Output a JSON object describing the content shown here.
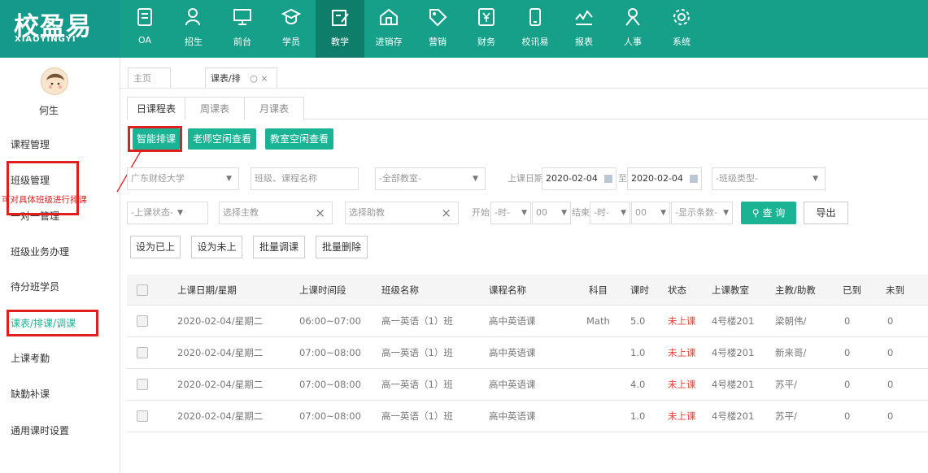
{
  "brand": {
    "name_cn": "校盈易",
    "name_en": "XIAOYINGYI"
  },
  "nav": [
    {
      "label": "OA",
      "icon": "oa-icon"
    },
    {
      "label": "招生",
      "icon": "recruit-icon"
    },
    {
      "label": "前台",
      "icon": "desk-icon"
    },
    {
      "label": "学员",
      "icon": "student-icon"
    },
    {
      "label": "教学",
      "icon": "teaching-icon",
      "active": true
    },
    {
      "label": "进销存",
      "icon": "inventory-icon"
    },
    {
      "label": "营销",
      "icon": "marketing-icon"
    },
    {
      "label": "财务",
      "icon": "finance-icon"
    },
    {
      "label": "校讯易",
      "icon": "phone-icon"
    },
    {
      "label": "报表",
      "icon": "report-icon"
    },
    {
      "label": "人事",
      "icon": "personnel-icon"
    },
    {
      "label": "系统",
      "icon": "settings-icon"
    }
  ],
  "user": {
    "name": "何生"
  },
  "sidebar": [
    {
      "label": "课程管理"
    },
    {
      "label": "班级管理"
    },
    {
      "label": "一对一管理"
    },
    {
      "label": "班级业务办理"
    },
    {
      "label": "待分班学员"
    },
    {
      "label": "课表/排课/调课",
      "active": true
    },
    {
      "label": "上课考勤"
    },
    {
      "label": "缺勤补课"
    },
    {
      "label": "通用课时设置"
    }
  ],
  "annotation": "可对具体班级进行排课",
  "page_tabs": [
    {
      "label": "主页"
    },
    {
      "label": "课表/排"
    }
  ],
  "page_tab_close": "○ ×",
  "sub_tabs": [
    "日课程表",
    "周课表",
    "月课表"
  ],
  "action_buttons": [
    "智能排课",
    "老师空闲查看",
    "教室空闲查看"
  ],
  "filters": {
    "school": "广东财经大学",
    "class_course_placeholder": "班级、课程名称",
    "classroom": "-全部教室-",
    "date_label": "上课日期",
    "date_from": "2020-02-04",
    "date_to_sep": "至",
    "date_to": "2020-02-04",
    "class_type": "-班级类型-",
    "status": "-上课状态-",
    "teacher_placeholder": "选择主教",
    "assistant_placeholder": "选择助教",
    "start_label": "开始",
    "start_hour": "-时-",
    "start_min": "00",
    "end_label": "结束",
    "end_hour": "-时-",
    "end_min": "00",
    "show_count": "-显示条数-",
    "query": "查 询",
    "export": "导出"
  },
  "batch_buttons": [
    "设为已上",
    "设为未上",
    "批量调课",
    "批量删除"
  ],
  "table": {
    "headers": [
      "上课日期/星期",
      "上课时间段",
      "班级名称",
      "课程名称",
      "科目",
      "课时",
      "状态",
      "上课教室",
      "主教/助教",
      "已到",
      "未到"
    ],
    "rows": [
      [
        "2020-02-04/星期二",
        "06:00~07:00",
        "高一英语（1）班",
        "高中英语课",
        "Math",
        "5.0",
        "未上课",
        "4号楼201",
        "梁朝伟/",
        "0",
        "0"
      ],
      [
        "2020-02-04/星期二",
        "07:00~08:00",
        "高一英语（1）班",
        "高中英语课",
        "",
        "1.0",
        "未上课",
        "4号楼201",
        "新来哥/",
        "0",
        "0"
      ],
      [
        "2020-02-04/星期二",
        "07:00~08:00",
        "高一英语（1）班",
        "高中英语课",
        "",
        "4.0",
        "未上课",
        "4号楼201",
        "苏平/",
        "0",
        "0"
      ],
      [
        "2020-02-04/星期二",
        "07:00~08:00",
        "高一英语（1）班",
        "高中英语课",
        "",
        "1.0",
        "未上课",
        "4号楼201",
        "苏平/",
        "0",
        "0"
      ]
    ]
  },
  "colors": {
    "brand": "#16a089",
    "accent": "#1ab394",
    "highlight": "#e0201f",
    "status_red": "#ea4335"
  }
}
